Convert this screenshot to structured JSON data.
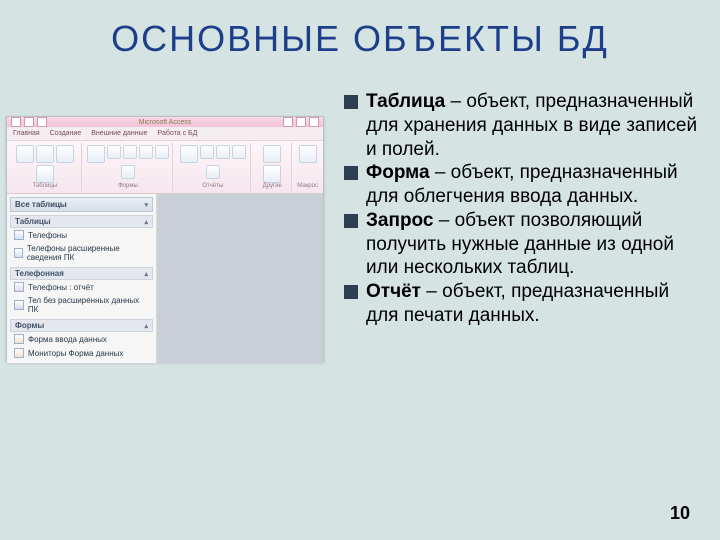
{
  "title": "ОСНОВНЫЕ  ОБЪЕКТЫ  БД",
  "page_number": "10",
  "bullets": [
    {
      "term": "Таблица",
      "desc": " – объект, предназначенный для хранения  данных  в виде записей и полей."
    },
    {
      "term": "Форма",
      "desc": " – объект, предназначенный для облегчения ввода данных."
    },
    {
      "term": "Запрос",
      "desc": " – объект позволяющий получить нужные данные из одной или нескольких таблиц."
    },
    {
      "term": "Отчёт",
      "desc": " – объект, предназначенный для печати данных."
    }
  ],
  "app": {
    "titlebar": "Microsoft Access",
    "tabs": [
      "Главная",
      "Создание",
      "Внешние данные",
      "Работа с БД"
    ],
    "groups": [
      "Таблицы",
      "Формы",
      "Отчёты",
      "Другие",
      "Макрос"
    ],
    "nav_header": "Все таблицы",
    "sections": [
      {
        "name": "Таблицы",
        "items": [
          "Телефоны",
          "Телефоны расширенные сведения ПК"
        ]
      },
      {
        "name": "Телефонная",
        "items": [
          "Телефоны : отчёт",
          "Тел без расширенных данных ПК"
        ]
      },
      {
        "name": "Формы",
        "items": [
          "Форма ввода данных",
          "Мониторы Форма данных"
        ]
      }
    ]
  }
}
